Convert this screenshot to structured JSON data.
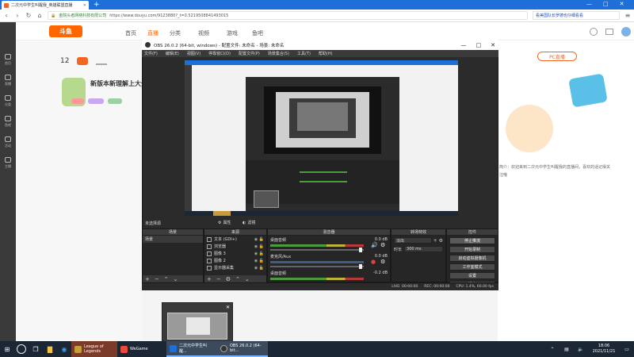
{
  "browser": {
    "tab_title": "二次元中学生叫醒我_英雄联盟直播",
    "url_host": "金院头者网络科技有限公司",
    "url_text": "https://www.douyu.com/9123880?_t=0.5219508841493015",
    "search_text": "看美国队长罗德也仔细看看"
  },
  "douyu": {
    "logo": "斗鱼",
    "nav": [
      "首页",
      "直播",
      "分类",
      "视频",
      "游戏",
      "鱼吧"
    ],
    "fans_count": "12",
    "banner_title": "新版本新理解上大分",
    "pc_live_badge": "PC直播",
    "intro_text": "简介：欢迎来到二次元中学生叫醒我的直播间，喜欢的话记得关注哦",
    "left_nav": [
      "首页",
      "直播",
      "分类",
      "鱼吧",
      "活动",
      "主播"
    ]
  },
  "obs": {
    "title": "OBS 26.0.2 (64-bit, windows) - 配置文件: 未命名 - 场景: 未命名",
    "menu": [
      "文件(F)",
      "编辑(E)",
      "视图(V)",
      "停靠窗口(D)",
      "配置文件(P)",
      "场景集合(S)",
      "工具(T)",
      "帮助(H)"
    ],
    "no_source_label": "未选择源",
    "properties_btn": "属性",
    "filters_btn": "滤镜",
    "panels": {
      "scenes": "场景",
      "sources": "来源",
      "mixer": "混音器",
      "transitions": "转场特效",
      "controls": "控件"
    },
    "scenes": [
      "场景"
    ],
    "sources": [
      {
        "name": "文本 (GDI+)",
        "icon": "text-icon"
      },
      {
        "name": "浏览器",
        "icon": "browser-icon"
      },
      {
        "name": "图像 3",
        "icon": "image-icon"
      },
      {
        "name": "图像 2",
        "icon": "image-icon"
      },
      {
        "name": "显示器采集",
        "icon": "monitor-icon"
      }
    ],
    "mixer": [
      {
        "name": "桌面音频",
        "db": "0.0 dB"
      },
      {
        "name": "麦克风/Aux",
        "db": "0.0 dB"
      },
      {
        "name": "桌面音频",
        "db": "-0.2 dB"
      }
    ],
    "transition": {
      "type": "淡出",
      "duration_label": "时长",
      "duration_value": "300 ms"
    },
    "controls": [
      "停止推流",
      "开始录制",
      "启动虚拟摄像机",
      "工作室模式",
      "设置",
      "退出"
    ],
    "status": {
      "live": "LIVE: 00:00:00",
      "rec": "REC: 00:00:00",
      "cpu": "CPU: 1.4%, 60.00 fps"
    }
  },
  "taskbar": {
    "apps": [
      {
        "name": "League of Legends",
        "color": "#c89b3c"
      },
      {
        "name": "WeGame",
        "color": "#e94b3c"
      },
      {
        "name": "二次元中学生叫醒...",
        "color": "#1f6fd8"
      },
      {
        "name": "OBS 26.0.2 (64-bit...",
        "color": "#333333"
      }
    ],
    "time": "18:06",
    "date": "2021/11/21"
  }
}
